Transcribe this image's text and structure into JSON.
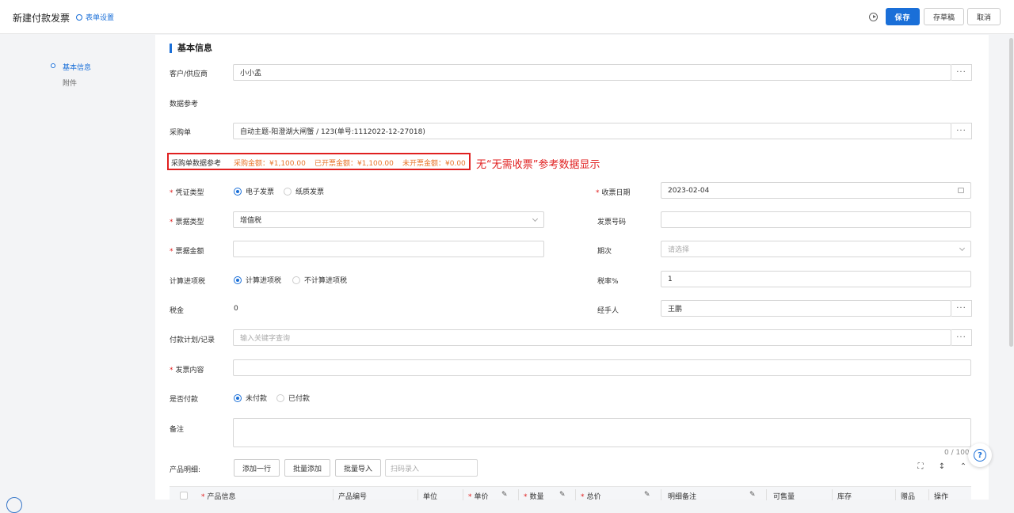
{
  "header": {
    "title": "新建付款发票",
    "form_settings": "表单设置",
    "save": "保存",
    "draft": "存草稿",
    "cancel": "取消"
  },
  "sidebar": {
    "items": [
      {
        "label": "基本信息",
        "active": true
      },
      {
        "label": "附件",
        "active": false
      }
    ]
  },
  "section": {
    "title": "基本信息"
  },
  "fields": {
    "customer_label": "客户/供应商",
    "customer_value": "小小孟",
    "data_ref_label": "数据参考",
    "po_label": "采购单",
    "po_value": "自动主题-阳澄湖大闸蟹 / 123(单号:1112022-12-27018)",
    "po_ref_label": "采购单数据参考",
    "po_amount": "采购金额：¥1,100.00",
    "invoiced_amount": "已开票金额：¥1,100.00",
    "uninvoiced_amount": "未开票金额：¥0.00",
    "annotation": "无“无需收票”参考数据显示",
    "voucher_type_label": "凭证类型",
    "voucher_opt1": "电子发票",
    "voucher_opt2": "纸质发票",
    "receive_date_label": "收票日期",
    "receive_date_value": "2023-02-04",
    "bill_type_label": "票据类型",
    "bill_type_value": "增值税",
    "invoice_no_label": "发票号码",
    "bill_amount_label": "票据金额",
    "period_label": "期次",
    "period_placeholder": "请选择",
    "input_tax_label": "计算进项税",
    "input_tax_opt1": "计算进项税",
    "input_tax_opt2": "不计算进项税",
    "tax_rate_label": "税率%",
    "tax_rate_value": "1",
    "tax_label": "税金",
    "tax_value": "0",
    "handler_label": "经手人",
    "handler_value": "王鹏",
    "payment_plan_label": "付款计划/记录",
    "payment_plan_placeholder": "输入关键字查询",
    "invoice_content_label": "发票内容",
    "paid_label": "是否付款",
    "paid_opt1": "未付款",
    "paid_opt2": "已付款",
    "remark_label": "备注",
    "remark_count": "0 / 100"
  },
  "products": {
    "label": "产品明细:",
    "add_row": "添加一行",
    "batch_add": "批量添加",
    "batch_import": "批量导入",
    "scan_placeholder": "扫码录入",
    "columns": [
      "产品信息",
      "产品编号",
      "单位",
      "单价",
      "数量",
      "总价",
      "明细备注",
      "可售量",
      "库存",
      "赠品",
      "操作"
    ]
  },
  "colors": {
    "primary": "#1a6fd8",
    "required": "#e02020",
    "amount": "#e8762c"
  }
}
